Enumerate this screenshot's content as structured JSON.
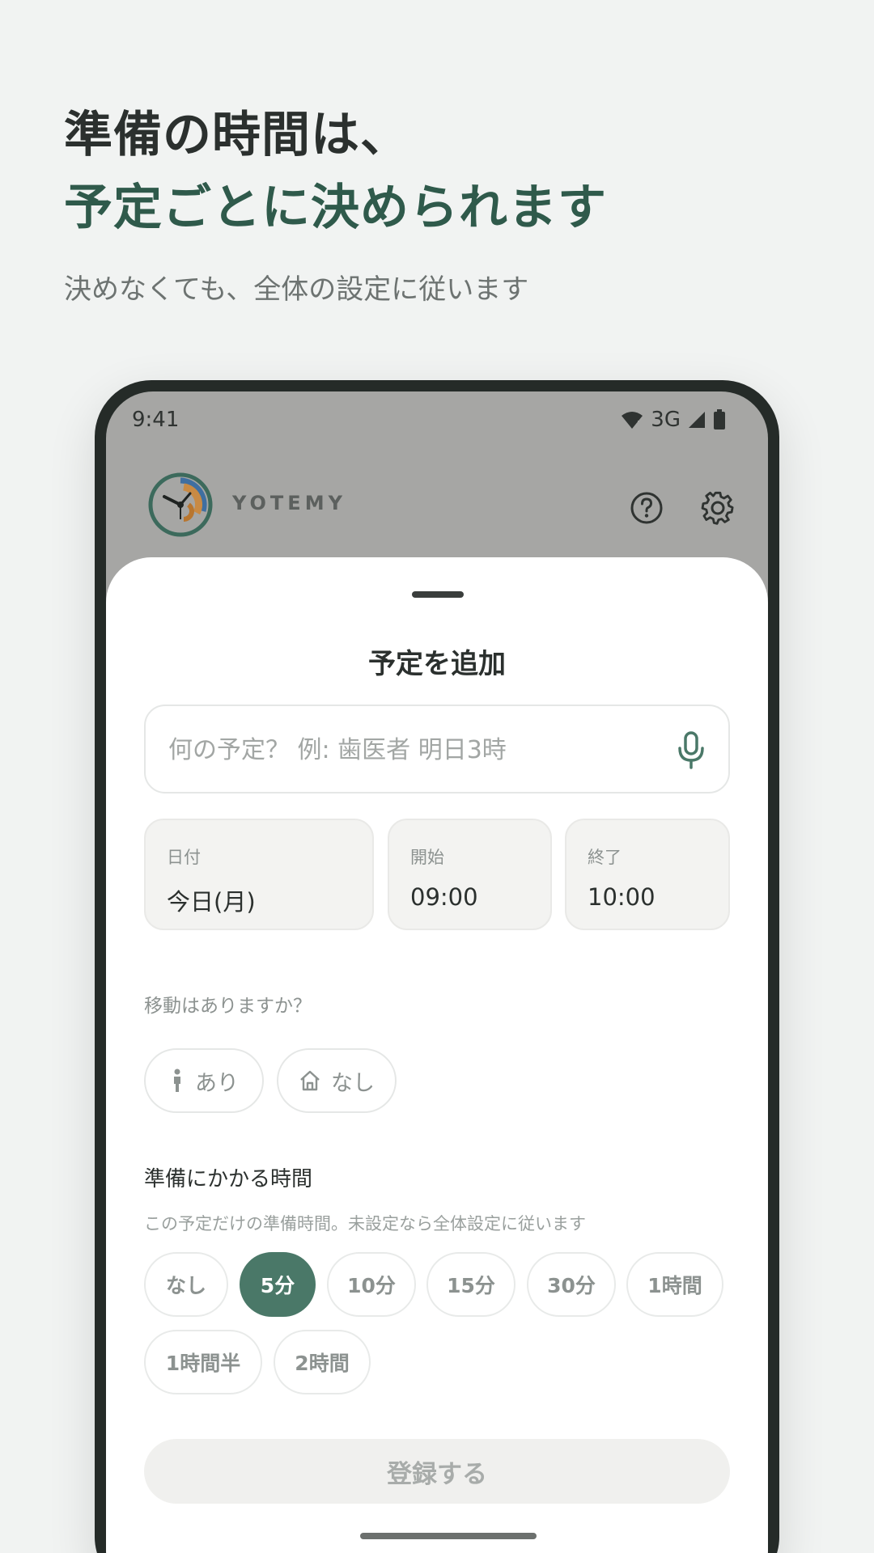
{
  "hero": {
    "line1": "準備の時間は、",
    "line2": "予定ごとに決められます",
    "subtitle": "決めなくても、全体の設定に従います"
  },
  "status_bar": {
    "time": "9:41",
    "network": "3G"
  },
  "app_bar": {
    "brand": "YOTEMY"
  },
  "sheet": {
    "title": "予定を追加",
    "input_placeholder": "何の予定？ 例: 歯医者 明日3時",
    "date": {
      "label": "日付",
      "value": "今日(月)"
    },
    "start": {
      "label": "開始",
      "value": "09:00"
    },
    "end": {
      "label": "終了",
      "value": "10:00"
    },
    "travel": {
      "question": "移動はありますか？",
      "yes_label": "あり",
      "no_label": "なし"
    },
    "prep": {
      "title": "準備にかかる時間",
      "subtitle": "この予定だけの準備時間。未設定なら全体設定に従います",
      "options": [
        "なし",
        "5分",
        "10分",
        "15分",
        "30分",
        "1時間",
        "1時間半",
        "2時間"
      ],
      "selected": "5分"
    },
    "submit_label": "登録する"
  },
  "colors": {
    "accent": "#4a7868",
    "headline_green": "#2f5a4b",
    "text_dark": "#2b302e",
    "text_muted": "#8c9290"
  }
}
